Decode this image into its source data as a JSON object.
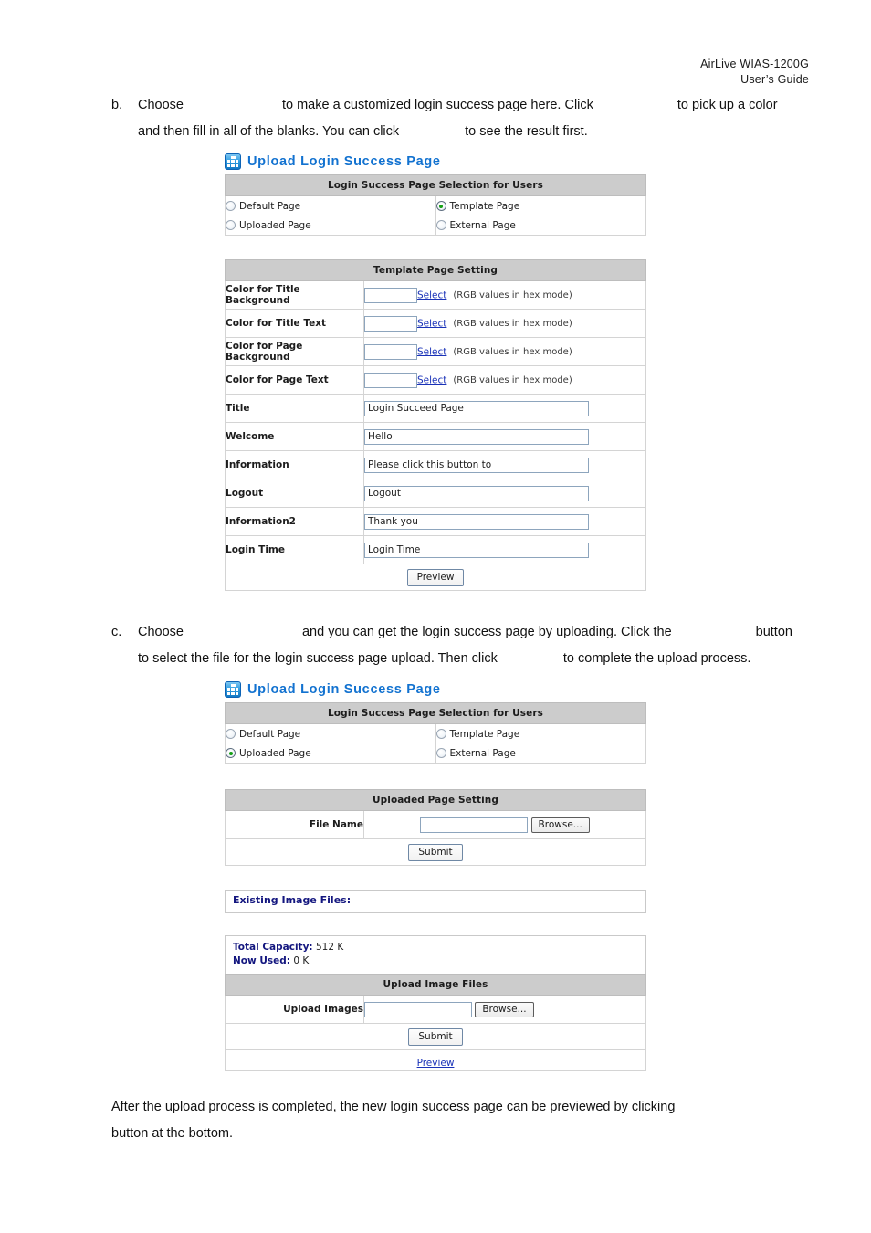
{
  "header": {
    "line1": "AirLive  WIAS-1200G",
    "line2": "User’s  Guide"
  },
  "paragraphs": {
    "b": {
      "marker": "b.",
      "line1_a": "Choose",
      "line1_b": "to make a customized login success page here. Click",
      "line1_c": "to pick up a color",
      "line2_a": "and then fill in all of the blanks. You can click",
      "line2_b": "to see the result first."
    },
    "c": {
      "marker": "c.",
      "line1_a": "Choose",
      "line1_b": "and you can get the login success page by uploading. Click the",
      "line1_c": "button",
      "line2_a": "to select the file for the login success page upload. Then click",
      "line2_b": "to complete the upload process."
    },
    "closing": {
      "line1": "After the upload process is completed, the new login success page can be previewed by clicking",
      "line2": "button at the bottom."
    }
  },
  "panel1": {
    "icon": "app-grid-icon",
    "title": "Upload Login Success Page",
    "selection": {
      "header": "Login Success Page Selection for Users",
      "options": [
        {
          "label": "Default Page",
          "selected": false
        },
        {
          "label": "Template Page",
          "selected": true
        },
        {
          "label": "Uploaded Page",
          "selected": false
        },
        {
          "label": "External Page",
          "selected": false
        }
      ]
    },
    "template_setting": {
      "header": "Template Page Setting",
      "hint": "(RGB values in hex mode)",
      "select_link": "Select",
      "color_rows": [
        {
          "label": "Color for Title Background",
          "value": ""
        },
        {
          "label": "Color for Title Text",
          "value": ""
        },
        {
          "label": "Color for Page Background",
          "value": ""
        },
        {
          "label": "Color for Page Text",
          "value": ""
        }
      ],
      "text_rows": [
        {
          "label": "Title",
          "value": "Login Succeed Page"
        },
        {
          "label": "Welcome",
          "value": "Hello"
        },
        {
          "label": "Information",
          "value": "Please click this button to"
        },
        {
          "label": "Logout",
          "value": "Logout"
        },
        {
          "label": "Information2",
          "value": "Thank you"
        },
        {
          "label": "Login Time",
          "value": "Login Time"
        }
      ],
      "preview_button": "Preview"
    }
  },
  "panel2": {
    "icon": "app-grid-icon",
    "title": "Upload Login Success Page",
    "selection": {
      "header": "Login Success Page Selection for Users",
      "options": [
        {
          "label": "Default Page",
          "selected": false
        },
        {
          "label": "Template Page",
          "selected": false
        },
        {
          "label": "Uploaded Page",
          "selected": true
        },
        {
          "label": "External Page",
          "selected": false
        }
      ]
    },
    "uploaded_setting": {
      "header": "Uploaded Page Setting",
      "file_label": "File Name",
      "file_value": "",
      "browse_button": "Browse...",
      "submit_button": "Submit"
    },
    "existing_images": {
      "label": "Existing Image Files:"
    },
    "capacity": {
      "total_label": "Total Capacity:",
      "total_value": "512 K",
      "used_label": "Now Used:",
      "used_value": "0 K"
    },
    "upload_images": {
      "header": "Upload Image Files",
      "label": "Upload Images",
      "value": "",
      "browse_button": "Browse...",
      "submit_button": "Submit",
      "preview_link": "Preview"
    }
  }
}
